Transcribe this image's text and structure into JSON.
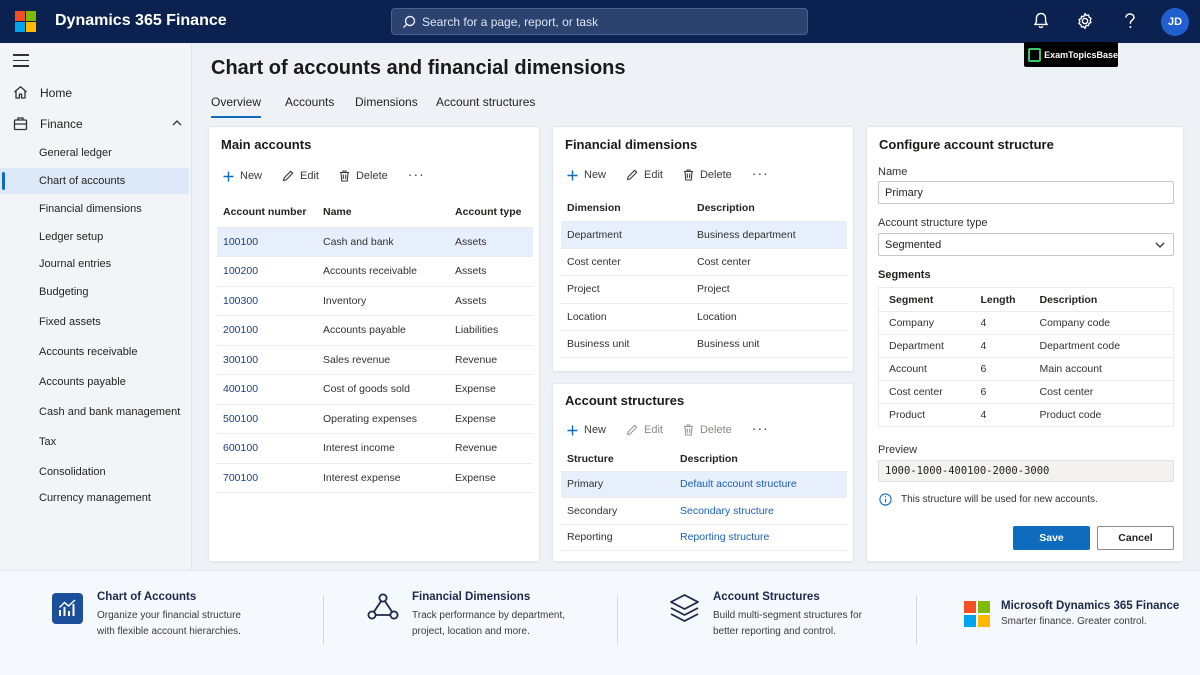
{
  "app": {
    "title": "Dynamics 365 Finance",
    "search_placeholder": "Search for a page, report, or task",
    "user_initials": "JD",
    "watermark": "ExamTopicsBase",
    "colors": {
      "topbar": "#0b2250",
      "accent": "#0f6cbd",
      "logo": [
        "#f25022",
        "#7fba00",
        "#00a4ef",
        "#ffb900"
      ]
    }
  },
  "sidebar": {
    "home": "Home",
    "finance": "Finance",
    "items": [
      {
        "label": "General ledger",
        "active": false
      },
      {
        "label": "Chart of accounts",
        "active": true
      },
      {
        "label": "Financial dimensions",
        "active": false
      },
      {
        "label": "Ledger setup",
        "active": false
      },
      {
        "label": "Journal entries",
        "active": false
      },
      {
        "label": "Budgeting",
        "active": false
      },
      {
        "label": "Fixed assets",
        "active": false
      },
      {
        "label": "Accounts receivable",
        "active": false
      },
      {
        "label": "Accounts payable",
        "active": false
      },
      {
        "label": "Cash and bank management",
        "active": false
      },
      {
        "label": "Tax",
        "active": false
      },
      {
        "label": "Consolidation",
        "active": false
      },
      {
        "label": "Currency management",
        "active": false
      }
    ]
  },
  "page": {
    "title": "Chart of accounts and financial dimensions",
    "tabs": [
      "Overview",
      "Accounts",
      "Dimensions",
      "Account structures"
    ],
    "active_tab": "Overview"
  },
  "toolbar": {
    "new": "New",
    "edit": "Edit",
    "delete": "Delete",
    "more": "···"
  },
  "main_accounts": {
    "title": "Main accounts",
    "columns": [
      "Account number",
      "Name",
      "Account type"
    ],
    "rows": [
      [
        "100100",
        "Cash and bank",
        "Assets"
      ],
      [
        "100200",
        "Accounts receivable",
        "Assets"
      ],
      [
        "100300",
        "Inventory",
        "Assets"
      ],
      [
        "200100",
        "Accounts payable",
        "Liabilities"
      ],
      [
        "300100",
        "Sales revenue",
        "Revenue"
      ],
      [
        "400100",
        "Cost of goods sold",
        "Expense"
      ],
      [
        "500100",
        "Operating expenses",
        "Expense"
      ],
      [
        "600100",
        "Interest income",
        "Revenue"
      ],
      [
        "700100",
        "Interest expense",
        "Expense"
      ]
    ]
  },
  "financial_dimensions": {
    "title": "Financial dimensions",
    "columns": [
      "Dimension",
      "Description"
    ],
    "rows": [
      [
        "Department",
        "Business department"
      ],
      [
        "Cost center",
        "Cost center"
      ],
      [
        "Project",
        "Project"
      ],
      [
        "Location",
        "Location"
      ],
      [
        "Business unit",
        "Business unit"
      ]
    ]
  },
  "account_structures": {
    "title": "Account structures",
    "columns": [
      "Structure",
      "Description"
    ],
    "rows": [
      [
        "Primary",
        "Default account structure"
      ],
      [
        "Secondary",
        "Secondary structure"
      ],
      [
        "Reporting",
        "Reporting structure"
      ]
    ]
  },
  "configure": {
    "title": "Configure account structure",
    "name_label": "Name",
    "name_value": "Primary",
    "type_label": "Account structure type",
    "type_value": "Segmented",
    "segments_label": "Segments",
    "segment_columns": [
      "Segment",
      "Length",
      "Description"
    ],
    "segments": [
      [
        "Company",
        "4",
        "Company code"
      ],
      [
        "Department",
        "4",
        "Department code"
      ],
      [
        "Account",
        "6",
        "Main account"
      ],
      [
        "Cost center",
        "6",
        "Cost center"
      ],
      [
        "Product",
        "4",
        "Product code"
      ]
    ],
    "preview_label": "Preview",
    "preview_value": "1000-1000-400100-2000-3000",
    "info_text": "This structure will be used for new accounts.",
    "save": "Save",
    "cancel": "Cancel"
  },
  "footer": {
    "items": [
      {
        "title": "Chart of Accounts",
        "desc": "Organize your financial structure with flexible account hierarchies."
      },
      {
        "title": "Financial Dimensions",
        "desc": "Track performance by department, project, location and more."
      },
      {
        "title": "Account Structures",
        "desc": "Build multi-segment structures for better reporting and control."
      },
      {
        "title": "Microsoft Dynamics 365 Finance",
        "desc": "Smarter finance. Greater control."
      }
    ]
  }
}
